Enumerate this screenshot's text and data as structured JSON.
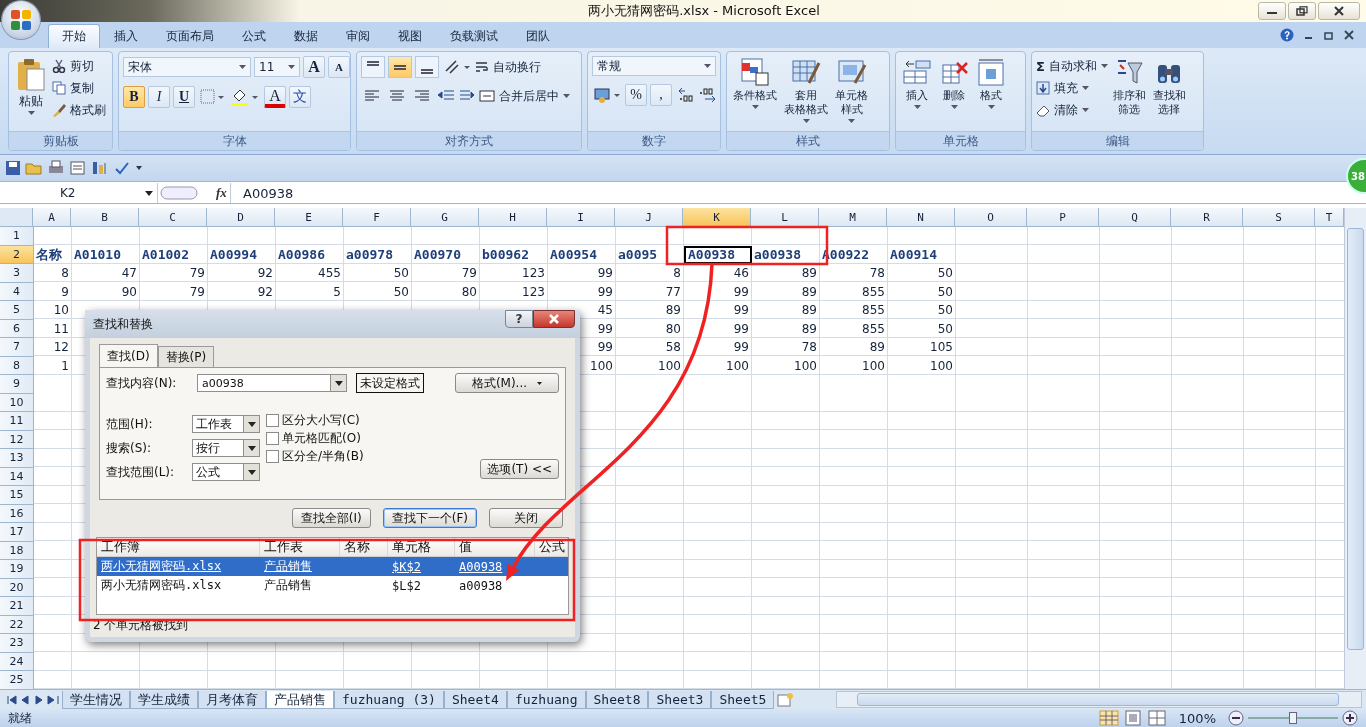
{
  "window": {
    "title": "两小无猜网密码.xlsx - Microsoft Excel",
    "badge": "38"
  },
  "ribbon_tabs": [
    {
      "label": "开始",
      "selected": true
    },
    {
      "label": "插入",
      "selected": false
    },
    {
      "label": "页面布局",
      "selected": false
    },
    {
      "label": "公式",
      "selected": false
    },
    {
      "label": "数据",
      "selected": false
    },
    {
      "label": "审阅",
      "selected": false
    },
    {
      "label": "视图",
      "selected": false
    },
    {
      "label": "负载测试",
      "selected": false
    },
    {
      "label": "团队",
      "selected": false
    }
  ],
  "clipboard": {
    "label": "剪贴板",
    "paste": "粘贴",
    "actions": [
      {
        "kind": "cut",
        "label": "剪切"
      },
      {
        "kind": "copy",
        "label": "复制"
      },
      {
        "kind": "brush",
        "label": "格式刷"
      }
    ]
  },
  "font": {
    "label": "字体",
    "name": "宋体",
    "size": "11",
    "grow": "A",
    "shrink": "A",
    "bold": "B",
    "italic": "I",
    "underline": "U",
    "bold_on": true,
    "color_letter": "A",
    "phonetic": "文"
  },
  "alignment": {
    "label": "对齐方式",
    "vertical": [
      {
        "kind": "top",
        "selected": false
      },
      {
        "kind": "middle",
        "selected": true
      },
      {
        "kind": "bottom",
        "selected": false
      }
    ],
    "wrap": "自动换行",
    "merge": "合并后居中"
  },
  "number": {
    "label": "数字",
    "format": "常规",
    "percent": "%",
    "comma": ","
  },
  "styles": {
    "label": "样式",
    "buttons": [
      {
        "kind": "conditional",
        "lines": [
          "条件格式"
        ]
      },
      {
        "kind": "table",
        "lines": [
          "套用",
          "表格格式"
        ]
      },
      {
        "kind": "cellstyle",
        "lines": [
          "单元格",
          "样式"
        ]
      }
    ]
  },
  "cells": {
    "label": "单元格",
    "buttons": [
      {
        "kind": "insert",
        "lines": [
          "插入"
        ]
      },
      {
        "kind": "delete",
        "lines": [
          "删除"
        ]
      },
      {
        "kind": "format",
        "lines": [
          "格式"
        ]
      }
    ]
  },
  "editing": {
    "label": "编辑",
    "small": [
      {
        "kind": "sum",
        "icon": "Σ",
        "label": "自动求和"
      },
      {
        "kind": "fill",
        "label": "填充"
      },
      {
        "kind": "clear",
        "label": "清除"
      }
    ],
    "buttons": [
      {
        "kind": "sort",
        "lines": [
          "排序和",
          "筛选"
        ]
      },
      {
        "kind": "find",
        "lines": [
          "查找和",
          "选择"
        ]
      }
    ]
  },
  "formula_bar": {
    "name_box": "K2",
    "fx": "fx",
    "value": "A00938"
  },
  "sheet": {
    "columns": [
      {
        "label": "A",
        "selected": false
      },
      {
        "label": "B",
        "selected": false
      },
      {
        "label": "C",
        "selected": false
      },
      {
        "label": "D",
        "selected": false
      },
      {
        "label": "E",
        "selected": false
      },
      {
        "label": "F",
        "selected": false
      },
      {
        "label": "G",
        "selected": false
      },
      {
        "label": "H",
        "selected": false
      },
      {
        "label": "I",
        "selected": false
      },
      {
        "label": "J",
        "selected": false
      },
      {
        "label": "K",
        "selected": true
      },
      {
        "label": "L",
        "selected": false
      },
      {
        "label": "M",
        "selected": false
      },
      {
        "label": "N",
        "selected": false
      },
      {
        "label": "O",
        "selected": false
      },
      {
        "label": "P",
        "selected": false
      },
      {
        "label": "Q",
        "selected": false
      },
      {
        "label": "R",
        "selected": false
      },
      {
        "label": "S",
        "selected": false
      },
      {
        "label": "T",
        "selected": false
      }
    ],
    "rows": [
      {
        "number": "1",
        "selected": false
      },
      {
        "number": "2",
        "selected": true,
        "kind": "header",
        "cells": [
          "名称",
          "A01010",
          "A01002",
          "A00994",
          "A00986",
          "a00978",
          "A00970",
          "b00962",
          "A00954",
          "a0095",
          "A00938",
          "a00938",
          "A00922",
          "A00914"
        ]
      },
      {
        "number": "3",
        "selected": false,
        "kind": "data",
        "cells": [
          "8",
          "47",
          "79",
          "92",
          "455",
          "50",
          "79",
          "123",
          "99",
          "8",
          "46",
          "89",
          "78",
          "50"
        ]
      },
      {
        "number": "4",
        "selected": false,
        "kind": "data",
        "cells": [
          "9",
          "90",
          "79",
          "92",
          "5",
          "50",
          "80",
          "123",
          "99",
          "77",
          "99",
          "89",
          "855",
          "50"
        ]
      },
      {
        "number": "5",
        "selected": false,
        "kind": "data",
        "cells": [
          "10",
          null,
          null,
          null,
          null,
          null,
          null,
          null,
          "45",
          "89",
          "99",
          "89",
          "855",
          "50"
        ]
      },
      {
        "number": "6",
        "selected": false,
        "kind": "data",
        "cells": [
          "11",
          null,
          null,
          null,
          null,
          null,
          null,
          null,
          "99",
          "80",
          "99",
          "89",
          "855",
          "50"
        ]
      },
      {
        "number": "7",
        "selected": false,
        "kind": "data",
        "cells": [
          "12",
          null,
          null,
          null,
          null,
          null,
          null,
          null,
          "99",
          "58",
          "99",
          "78",
          "89",
          "105"
        ]
      },
      {
        "number": "8",
        "selected": false,
        "kind": "data",
        "cells": [
          "1",
          null,
          null,
          null,
          null,
          null,
          null,
          null,
          "100",
          "100",
          "100",
          "100",
          "100",
          "100"
        ]
      },
      {
        "number": "9",
        "selected": false
      },
      {
        "number": "10",
        "selected": false
      },
      {
        "number": "11",
        "selected": false
      },
      {
        "number": "12",
        "selected": false
      },
      {
        "number": "13",
        "selected": false
      },
      {
        "number": "14",
        "selected": false
      },
      {
        "number": "15",
        "selected": false
      },
      {
        "number": "16",
        "selected": false
      },
      {
        "number": "17",
        "selected": false
      },
      {
        "number": "18",
        "selected": false
      },
      {
        "number": "19",
        "selected": false
      },
      {
        "number": "20",
        "selected": false
      },
      {
        "number": "21",
        "selected": false
      },
      {
        "number": "22",
        "selected": false
      },
      {
        "number": "23",
        "selected": false
      },
      {
        "number": "24",
        "selected": false
      },
      {
        "number": "25",
        "selected": false
      }
    ]
  },
  "find_dialog": {
    "title": "查找和替换",
    "help": "?",
    "tabs": [
      {
        "label": "查找(D)",
        "selected": true
      },
      {
        "label": "替换(P)",
        "selected": false
      }
    ],
    "find_label": "查找内容(N):",
    "find_value": "a00938",
    "format_preview": "未设定格式",
    "format_button": "格式(M)...",
    "selects": [
      {
        "label": "范围(H):",
        "value": "工作表"
      },
      {
        "label": "搜索(S):",
        "value": "按行"
      },
      {
        "label": "查找范围(L):",
        "value": "公式"
      }
    ],
    "options": [
      {
        "label": "区分大小写(C)",
        "checked": false
      },
      {
        "label": "单元格匹配(O)",
        "checked": false
      },
      {
        "label": "区分全/半角(B)",
        "checked": false
      }
    ],
    "options_button": "选项(T) <<",
    "buttons": [
      {
        "label": "查找全部(I)",
        "selected": false
      },
      {
        "label": "查找下一个(F)",
        "selected": true
      },
      {
        "label": "关闭",
        "selected": false
      }
    ],
    "results": {
      "columns": [
        "工作簿",
        "工作表",
        "名称",
        "单元格",
        "值",
        "公式"
      ],
      "rows": [
        {
          "selected": true,
          "cells": [
            "两小无猜网密码.xlsx",
            "产品销售",
            null,
            "$K$2",
            "A00938",
            null
          ]
        },
        {
          "selected": false,
          "cells": [
            "两小无猜网密码.xlsx",
            "产品销售",
            null,
            "$L$2",
            "a00938",
            null
          ]
        }
      ]
    },
    "status": "2 个单元格被找到"
  },
  "sheet_tabs": [
    {
      "label": "学生情况",
      "selected": false
    },
    {
      "label": "学生成绩",
      "selected": false
    },
    {
      "label": "月考体育",
      "selected": false
    },
    {
      "label": "产品销售",
      "selected": true
    },
    {
      "label": "fuzhuang (3)",
      "selected": false
    },
    {
      "label": "Sheet4",
      "selected": false
    },
    {
      "label": "fuzhuang",
      "selected": false
    },
    {
      "label": "Sheet8",
      "selected": false
    },
    {
      "label": "Sheet3",
      "selected": false
    },
    {
      "label": "Sheet5",
      "selected": false
    }
  ],
  "status_bar": {
    "text": "就绪",
    "zoom": "100%",
    "zoom_slider": {
      "level": 0.5
    }
  }
}
